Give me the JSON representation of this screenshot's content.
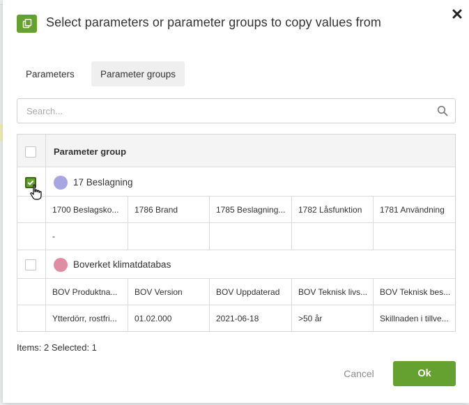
{
  "dialog": {
    "title": "Select parameters or parameter groups to copy values from",
    "accent_color": "#65a130",
    "header_icon": "copy-icon",
    "close_icon": "close-icon"
  },
  "tabs": [
    {
      "label": "Parameters",
      "active": false
    },
    {
      "label": "Parameter groups",
      "active": true
    }
  ],
  "search": {
    "placeholder": "Search...",
    "value": "",
    "icon": "search-icon"
  },
  "table": {
    "header": "Parameter group",
    "groups": [
      {
        "name": "17 Beslagning",
        "color": "#a7a6e3",
        "checked": true,
        "columns": [
          "1700 Beslagsko...",
          "1786 Brand",
          "1785 Beslagning...",
          "1782 Låsfunktion",
          "1781 Användning"
        ],
        "values": [
          "-",
          "",
          "",
          "",
          ""
        ]
      },
      {
        "name": "Boverket klimatdatabas",
        "color": "#e08ca2",
        "checked": false,
        "columns": [
          "BOV Produktna...",
          "BOV Version",
          "BOV Uppdaterad",
          "BOV Teknisk livs...",
          "BOV Teknisk bes..."
        ],
        "values": [
          "Ytterdörr, rostfri...",
          "01.02.000",
          "2021-06-18",
          ">50 år",
          "Skillnaden i tillve..."
        ]
      }
    ]
  },
  "footer": {
    "count_text": "Items: 2 Selected: 1",
    "cancel_label": "Cancel",
    "ok_label": "Ok"
  }
}
